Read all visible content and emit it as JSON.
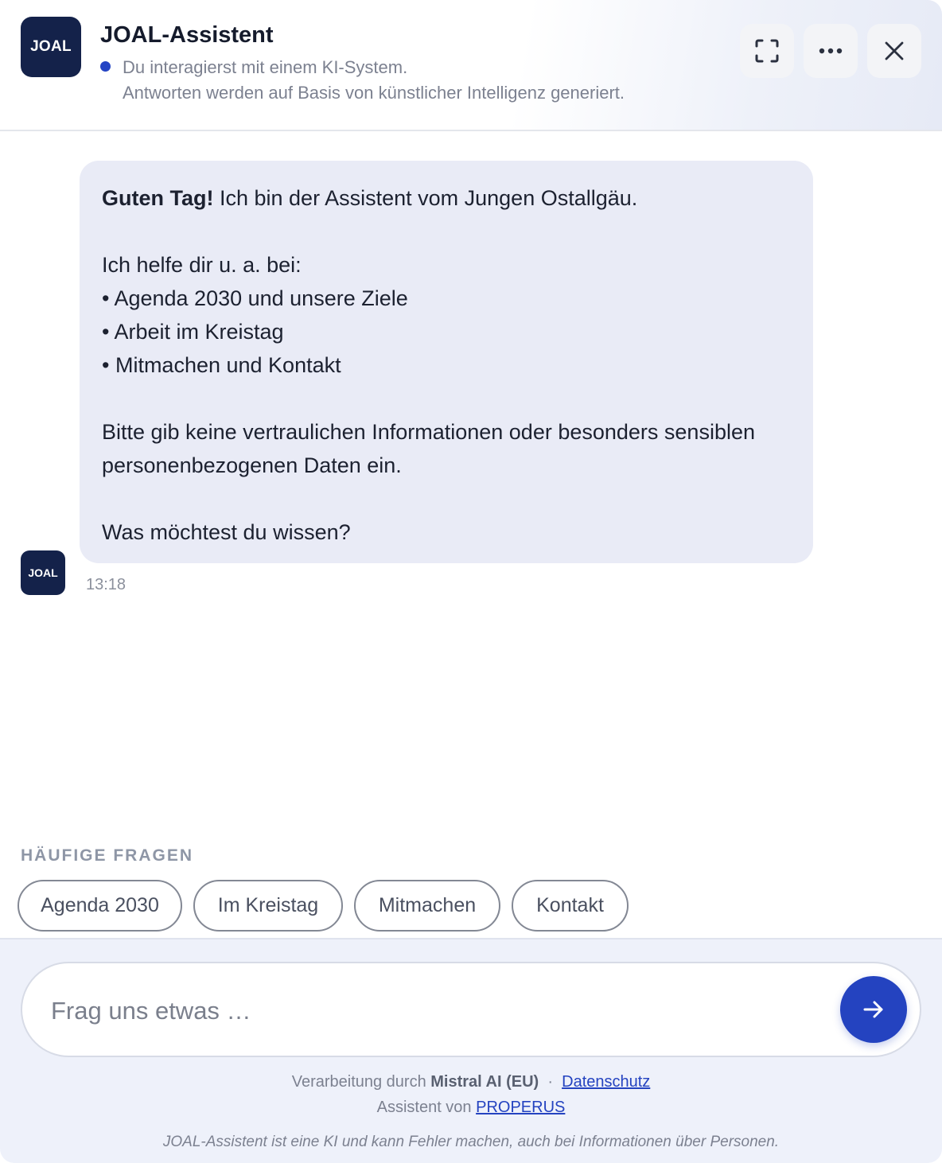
{
  "header": {
    "logo_text": "JOAL",
    "title": "JOAL-Assistent",
    "status": "Du interagierst mit einem KI-System.",
    "status_sub": "Antworten werden auf Basis von künstlicher Intelligenz generiert.",
    "status_color": "#2444c4",
    "buttons": [
      "expand-icon",
      "more-icon",
      "close-icon"
    ]
  },
  "message": {
    "greeting_bold": "Guten Tag!",
    "greeting_rest": " Ich bin der Assistent vom Jungen Ostallgäu.",
    "intro": "Ich helfe dir u. a. bei:",
    "items": [
      "• Agenda 2030 und unsere Ziele",
      "• Arbeit im Kreistag",
      "• Mitmachen und Kontakt"
    ],
    "warning_1": "Bitte gib keine vertraulichen Informationen oder besonders sensiblen",
    "warning_2": "personenbezogenen Daten ein.",
    "question": "Was möchtest du wissen?",
    "avatar_text": "JOAL",
    "time": "13:18"
  },
  "faq": {
    "title": "HÄUFIGE FRAGEN",
    "chips": [
      "Agenda 2030",
      "Im Kreistag",
      "Mitmachen",
      "Kontakt"
    ]
  },
  "composer": {
    "placeholder": "Frag uns etwas …",
    "send_icon": "arrow-right-icon",
    "accent": "#2443c0"
  },
  "footer": {
    "processing_prefix": "Verarbeitung durch ",
    "processing_provider": "Mistral AI (EU)",
    "separator": "·",
    "privacy_link": "Datenschutz",
    "assistant_prefix": "Assistent von ",
    "assistant_link": "PROPERUS",
    "disclaimer": "JOAL-Assistent ist eine KI und kann Fehler machen, auch bei Informationen über Personen."
  }
}
